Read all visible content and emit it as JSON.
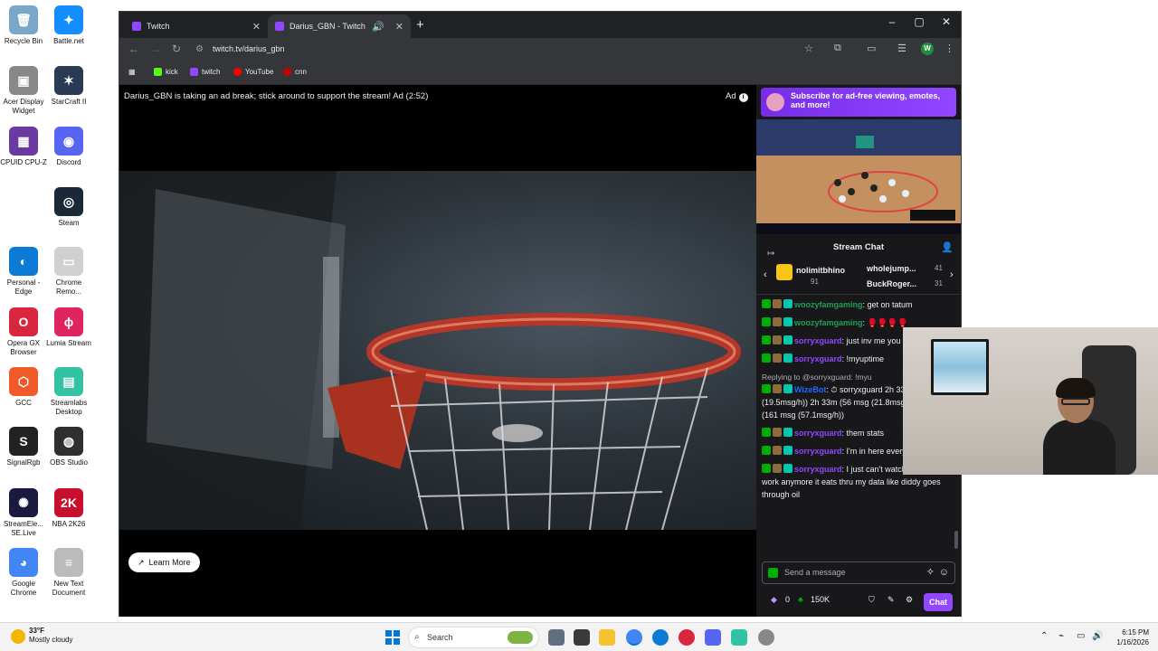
{
  "desktop": {
    "icons": [
      {
        "label": "Recycle Bin",
        "glyph": "🗑",
        "color": "#7aa7c7"
      },
      {
        "label": "Battle.net",
        "glyph": "✦",
        "color": "#148eff"
      },
      {
        "label": "Acer Display Widget",
        "glyph": "▣",
        "color": "#888888"
      },
      {
        "label": "StarCraft II",
        "glyph": "✶",
        "color": "#2a3a55"
      },
      {
        "label": "CPUID CPU-Z",
        "glyph": "▦",
        "color": "#6a3aa0"
      },
      {
        "label": "Discord",
        "glyph": "◉",
        "color": "#5865f2"
      },
      {
        "label": "Steam",
        "glyph": "◎",
        "color": "#1b2838"
      },
      {
        "label": "Personal - Edge",
        "glyph": "◐",
        "color": "#0c7bd6"
      },
      {
        "label": "Chrome Remo...",
        "glyph": "▭",
        "color": "#d0d0d0"
      },
      {
        "label": "Opera GX Browser",
        "glyph": "O",
        "color": "#d7263d"
      },
      {
        "label": "Lumia Stream",
        "glyph": "ϕ",
        "color": "#e0245e"
      },
      {
        "label": "GCC",
        "glyph": "⬡",
        "color": "#f05a28"
      },
      {
        "label": "Streamlabs Desktop",
        "glyph": "▤",
        "color": "#31c3a2"
      },
      {
        "label": "SignalRgb",
        "glyph": "S",
        "color": "#222222"
      },
      {
        "label": "OBS Studio",
        "glyph": "◍",
        "color": "#302e31"
      },
      {
        "label": "StreamEle... SE.Live",
        "glyph": "✺",
        "color": "#1a1a40"
      },
      {
        "label": "NBA 2K26",
        "glyph": "2K",
        "color": "#c8102e"
      },
      {
        "label": "Google Chrome",
        "glyph": "◕",
        "color": "#4285f4"
      },
      {
        "label": "New Text Document",
        "glyph": "≡",
        "color": "#bbbbbb"
      }
    ]
  },
  "browser": {
    "tabs": [
      {
        "label": "Twitch",
        "active": false
      },
      {
        "label": "Darius_GBN - Twitch",
        "active": true
      }
    ],
    "url": "twitch.tv/darius_gbn",
    "avatar_letter": "W",
    "bookmarks": [
      {
        "label": "kick",
        "color": "#53fc18"
      },
      {
        "label": "twitch",
        "color": "#9146ff"
      },
      {
        "label": "YouTube",
        "color": "#ff0000"
      },
      {
        "label": "cnn",
        "color": "#cc0000"
      }
    ]
  },
  "player": {
    "ad_banner": "Darius_GBN is taking an ad break; stick around to support the stream! Ad (2:52)",
    "ad_label": "Ad",
    "learn_more": "Learn More"
  },
  "chat": {
    "subscribe_banner": "Subscribe for ad-free viewing, emotes, and more!",
    "title": "Stream Chat",
    "leaderboard": [
      {
        "name": "nolimitbhino",
        "count": "91"
      },
      {
        "name": "wholejump...",
        "count": "41"
      },
      {
        "name": "BuckRoger...",
        "count": "31"
      }
    ],
    "messages": [
      {
        "user": "woozyfamgaming",
        "color": "#1e9e56",
        "text": ": get on tatum",
        "reply": ""
      },
      {
        "user": "woozyfamgaming",
        "color": "#1e9e56",
        "text": ": 🥊🥊🥊🥊",
        "reply": ""
      },
      {
        "user": "sorryxguard",
        "color": "#9147ff",
        "text": ": just inv me you need one pa",
        "reply": ""
      },
      {
        "user": "sorryxguard",
        "color": "#9147ff",
        "text": ": !myuptime",
        "reply": ""
      },
      {
        "user": "WizeBot",
        "color": "#1f69ff",
        "text": ": ⏱ sorryxguard 2h 33m (50 msg (19.5msg/h)) 2h 33m (56 msg (21.8msg/h)) 2h 49m (161 msg (57.1msg/h))",
        "reply": "Replying to @sorryxguard: !myu"
      },
      {
        "user": "sorryxguard",
        "color": "#9147ff",
        "text": ": them stats",
        "reply": ""
      },
      {
        "user": "sorryxguard",
        "color": "#9147ff",
        "text": ": I'm in here everytimewehoop",
        "reply": ""
      },
      {
        "user": "sorryxguard",
        "color": "#9147ff",
        "text": ": I just can't watch when I'm at work anymore it eats thru my data like diddy goes through oil",
        "reply": ""
      }
    ],
    "input_placeholder": "Send a message",
    "points": "0",
    "channel_points": "150K",
    "chat_button": "Chat"
  },
  "taskbar": {
    "temperature": "33°F",
    "weather": "Mostly cloudy",
    "search": "Search",
    "time": "6:15 PM",
    "date": "1/16/2026"
  }
}
